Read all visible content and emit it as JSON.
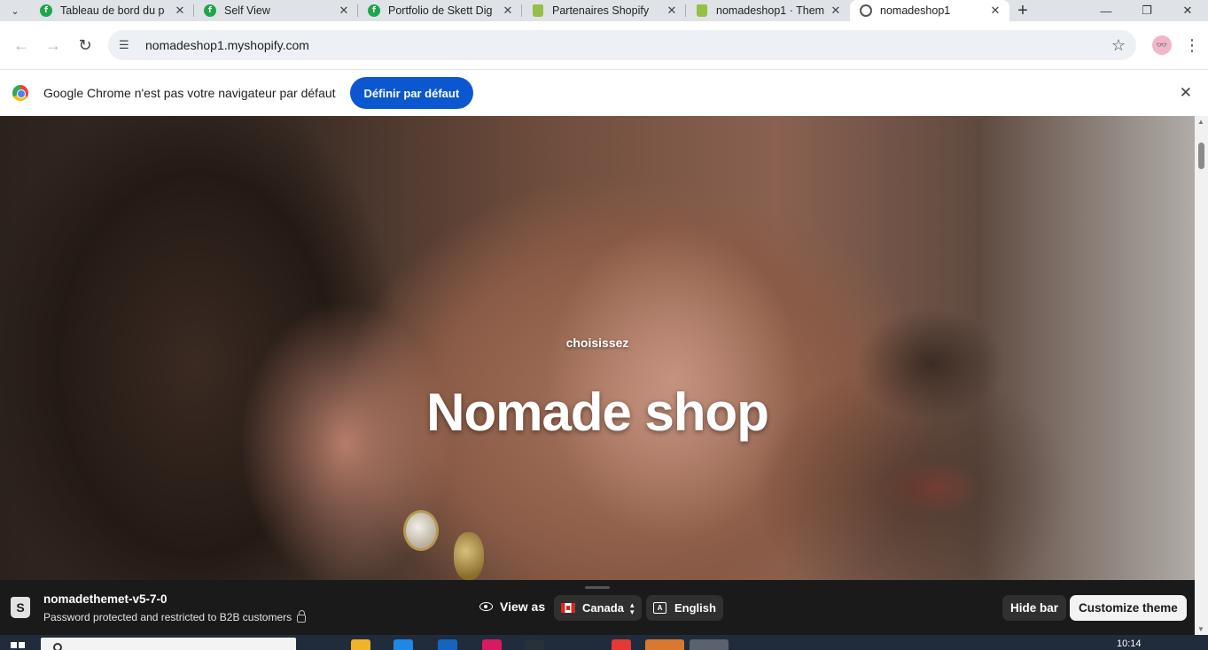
{
  "browser": {
    "tabs": [
      {
        "title": "Tableau de bord du p",
        "favicon": "green-f-icon",
        "active": false
      },
      {
        "title": "Self View",
        "favicon": "green-f-icon",
        "active": false
      },
      {
        "title": "Portfolio de Skett Dig",
        "favicon": "green-f-icon",
        "active": false
      },
      {
        "title": "Partenaires Shopify",
        "favicon": "shopify-bag-icon",
        "active": false
      },
      {
        "title": "nomadeshop1 · Them",
        "favicon": "shopify-bag-icon",
        "active": false
      },
      {
        "title": "nomadeshop1",
        "favicon": "globe-icon",
        "active": true
      }
    ],
    "url": "nomadeshop1.myshopify.com",
    "infobar": {
      "message": "Google Chrome n'est pas votre navigateur par défaut",
      "button": "Définir par défaut"
    }
  },
  "hero": {
    "eyebrow": "choisissez",
    "heading": "Nomade shop"
  },
  "preview_bar": {
    "theme_name": "nomadethemet-v5-7-0",
    "status": "Password protected and restricted to B2B customers",
    "view_as": "View as",
    "country": "Canada",
    "language": "English",
    "hide_button": "Hide bar",
    "customize_button": "Customize theme"
  },
  "taskbar": {
    "time": "10:14"
  }
}
